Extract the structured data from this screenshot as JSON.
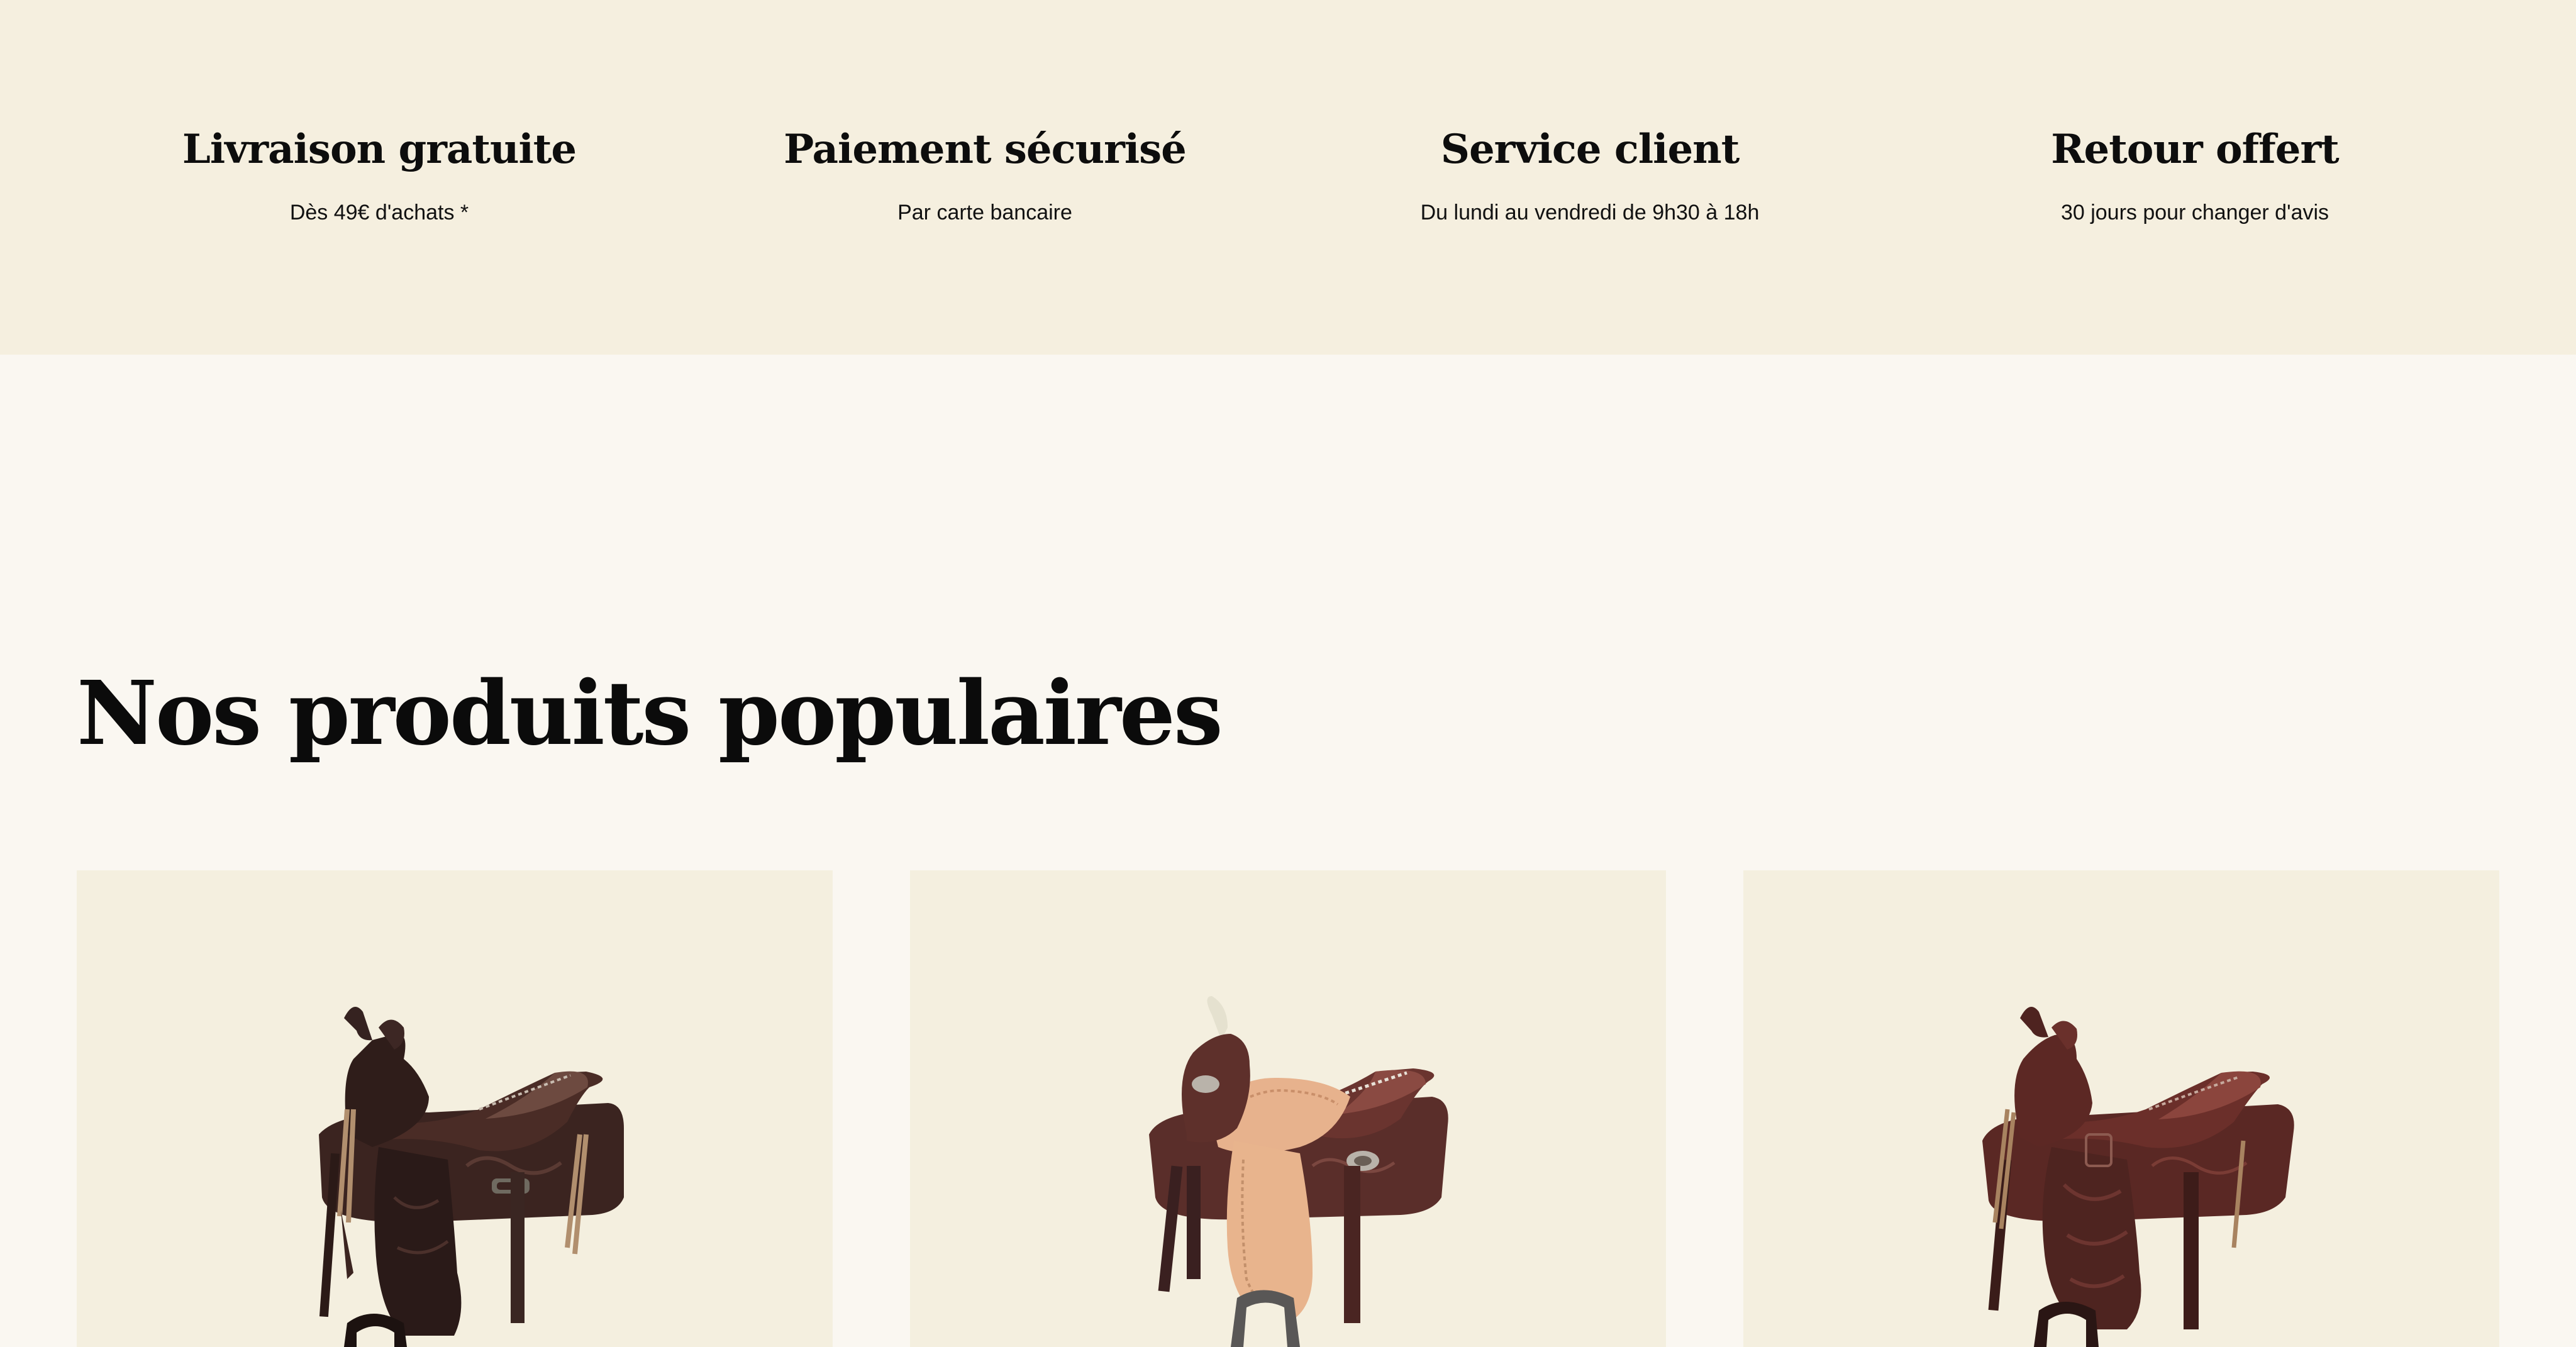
{
  "features": [
    {
      "title": "Livraison gratuite",
      "text": "Dès 49€ d'achats *"
    },
    {
      "title": "Paiement sécurisé",
      "text": "Par carte bancaire"
    },
    {
      "title": "Service client",
      "text": "Du lundi au vendredi de 9h30 à 18h"
    },
    {
      "title": "Retour offert",
      "text": "30 jours pour changer d'avis"
    }
  ],
  "popular": {
    "heading": "Nos produits populaires",
    "products": [
      {
        "image": "western-saddle-dark-brown"
      },
      {
        "image": "western-saddle-two-tone-tan-seat"
      },
      {
        "image": "western-saddle-reddish-brown"
      }
    ]
  },
  "colors": {
    "page_bg": "#faf7f1",
    "band_bg": "#f5efdf",
    "card_bg": "#f4efdf",
    "text": "#111111"
  }
}
